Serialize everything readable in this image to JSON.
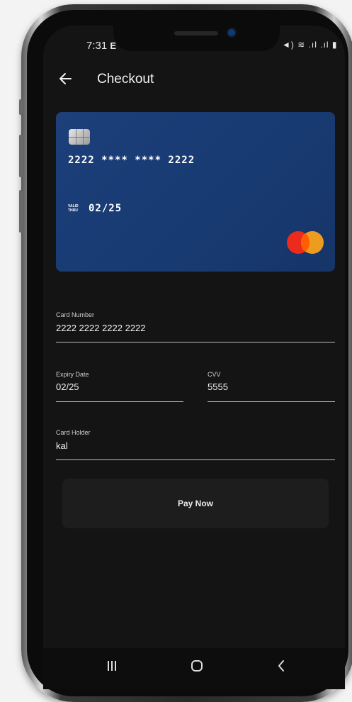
{
  "status_bar": {
    "time": "7:31",
    "icons": "◄) ≋ .ıl .ıl ▮",
    "left_icon": "E"
  },
  "app_bar": {
    "back_icon": "arrow-left-icon",
    "title": "Checkout"
  },
  "card": {
    "number_masked": "2222 **** **** 2222",
    "valid_thru_label_1": "VALID",
    "valid_thru_label_2": "THRU",
    "expiry": "02/25",
    "brand": "mastercard",
    "color": "#1d3f7a"
  },
  "form": {
    "card_number": {
      "label": "Card Number",
      "value": "2222 2222 2222 2222"
    },
    "expiry_date": {
      "label": "Expiry Date",
      "value": "02/25"
    },
    "cvv": {
      "label": "CVV",
      "value": "5555"
    },
    "card_holder": {
      "label": "Card Holder",
      "value": "kal"
    }
  },
  "pay_button": {
    "label": "Pay Now"
  },
  "nav_bar": {
    "recents_icon": "recents-icon",
    "home_icon": "home-icon",
    "back_icon": "back-chevron-icon"
  }
}
